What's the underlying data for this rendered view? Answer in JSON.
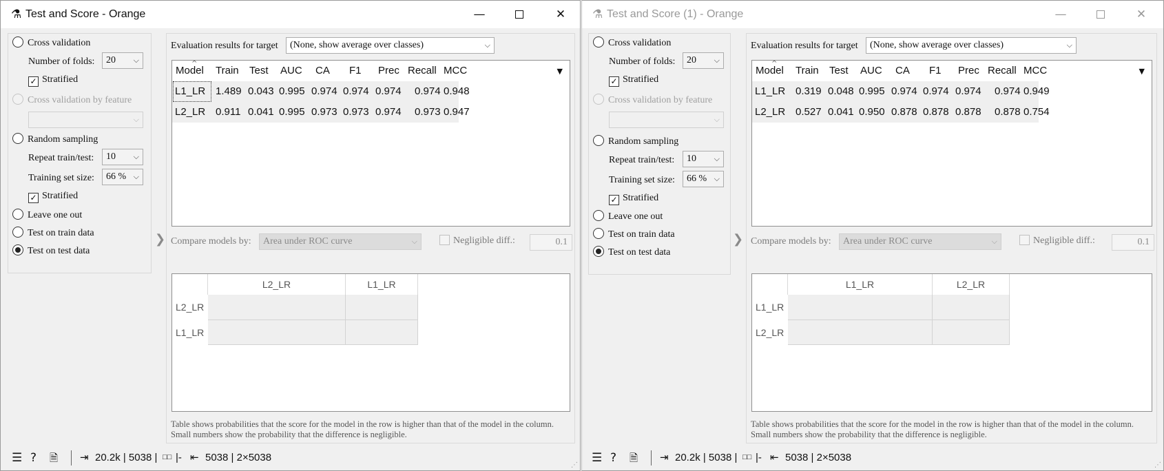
{
  "windows": [
    {
      "title": "Test and Score - Orange",
      "controls": {
        "cross_validation": "Cross validation",
        "number_of_folds_label": "Number of folds:",
        "number_of_folds": "20",
        "stratified": "Stratified",
        "cv_by_feature": "Cross validation by feature",
        "cv_feature_value": "",
        "random_sampling": "Random sampling",
        "repeat_label": "Repeat train/test:",
        "repeat": "10",
        "training_size_label": "Training set size:",
        "training_size": "66 %",
        "stratified2": "Stratified",
        "leave_one_out": "Leave one out",
        "test_on_train": "Test on train data",
        "test_on_test": "Test on test data",
        "selected": "Test on test data"
      },
      "eval_label": "Evaluation results for target",
      "target": "(None, show average over classes)",
      "columns": [
        "Model",
        "Train",
        "Test",
        "AUC",
        "CA",
        "F1",
        "Prec",
        "Recall",
        "MCC"
      ],
      "rows": [
        [
          "L1_LR",
          "1.489",
          "0.043",
          "0.995",
          "0.974",
          "0.974",
          "0.974",
          "0.974",
          "0.948"
        ],
        [
          "L2_LR",
          "0.911",
          "0.041",
          "0.995",
          "0.973",
          "0.973",
          "0.974",
          "0.973",
          "0.947"
        ]
      ],
      "compare_label": "Compare models by:",
      "compare_value": "Area under ROC curve",
      "negligible_label": "Negligible diff.:",
      "negligible_value": "0.1",
      "cmp_columns": [
        "L2_LR",
        "L1_LR"
      ],
      "cmp_rows": [
        "L2_LR",
        "L1_LR"
      ],
      "footnote": "Table shows probabilities that the score for the model in the row is higher than that of the model in the column. Small numbers show the probability that the difference is negligible.",
      "status": {
        "input": "20.2k | 5038 |",
        "input_tail": "|-",
        "output": "5038 | 2×5038"
      }
    },
    {
      "title": "Test and Score (1) - Orange",
      "controls": {
        "cross_validation": "Cross validation",
        "number_of_folds_label": "Number of folds:",
        "number_of_folds": "20",
        "stratified": "Stratified",
        "cv_by_feature": "Cross validation by feature",
        "cv_feature_value": "",
        "random_sampling": "Random sampling",
        "repeat_label": "Repeat train/test:",
        "repeat": "10",
        "training_size_label": "Training set size:",
        "training_size": "66 %",
        "stratified2": "Stratified",
        "leave_one_out": "Leave one out",
        "test_on_train": "Test on train data",
        "test_on_test": "Test on test data",
        "selected": "Test on test data"
      },
      "eval_label": "Evaluation results for target",
      "target": "(None, show average over classes)",
      "columns": [
        "Model",
        "Train",
        "Test",
        "AUC",
        "CA",
        "F1",
        "Prec",
        "Recall",
        "MCC"
      ],
      "rows": [
        [
          "L1_LR",
          "0.319",
          "0.048",
          "0.995",
          "0.974",
          "0.974",
          "0.974",
          "0.974",
          "0.949"
        ],
        [
          "L2_LR",
          "0.527",
          "0.041",
          "0.950",
          "0.878",
          "0.878",
          "0.878",
          "0.878",
          "0.754"
        ]
      ],
      "compare_label": "Compare models by:",
      "compare_value": "Area under ROC curve",
      "negligible_label": "Negligible diff.:",
      "negligible_value": "0.1",
      "cmp_columns": [
        "L1_LR",
        "L2_LR"
      ],
      "cmp_rows": [
        "L1_LR",
        "L2_LR"
      ],
      "footnote": "Table shows probabilities that the score for the model in the row is higher than that of the model in the column. Small numbers show the probability that the difference is negligible.",
      "status": {
        "input": "20.2k | 5038 |",
        "input_tail": "|-",
        "output": "5038 | 2×5038"
      }
    }
  ]
}
